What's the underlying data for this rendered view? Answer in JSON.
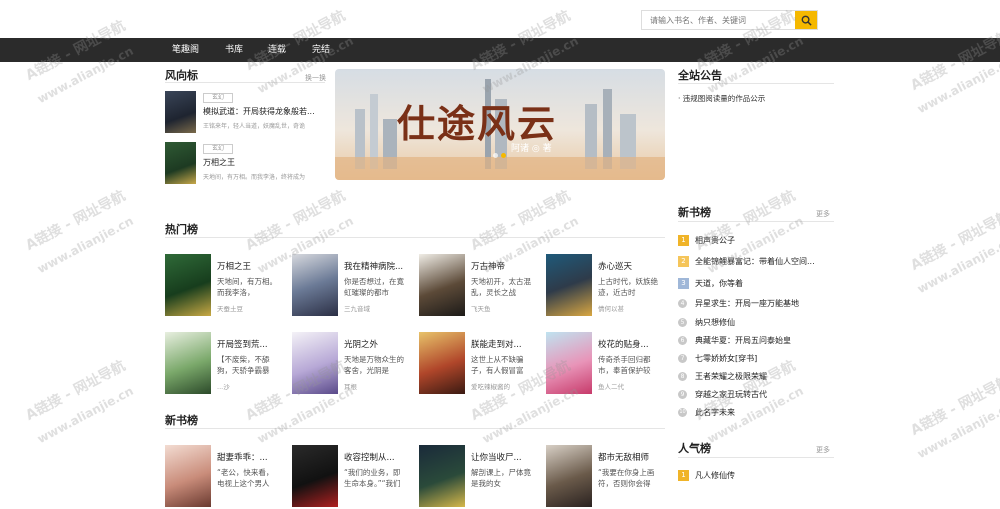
{
  "header": {
    "search_placeholder": "请输入书名、作者、关键词",
    "search_icon": "search-icon"
  },
  "nav": {
    "items": [
      "笔趣阁",
      "书库",
      "连载",
      "完结"
    ]
  },
  "fengxiang": {
    "title": "风向标",
    "more": "换一换",
    "items": [
      {
        "tag": "玄幻",
        "title": "模拟武道：开局获得龙象般若...",
        "desc": "王铭来年，轻人当道，妖魔乱世，奇诡"
      },
      {
        "tag": "玄幻",
        "title": "万相之王",
        "desc": "天地间，有万相。而我李洛，终将成为"
      }
    ]
  },
  "banner": {
    "title": "仕途风云",
    "author": "阿诸 ◎ 著",
    "active_dot": 1
  },
  "announcement": {
    "title": "全站公告",
    "items": [
      "· 违规图阅读量的作品公示"
    ]
  },
  "hot": {
    "title": "热门榜",
    "books": [
      {
        "title": "万相之王",
        "desc": "天地间，有万相。而我李洛，",
        "author": "天蚕土豆"
      },
      {
        "title": "我在精神病院...",
        "desc": "你是否想过，在寛虹璀璨的都市",
        "author": "三九音域"
      },
      {
        "title": "万古神帝",
        "desc": "天地初开，太古混乱，灵长之战",
        "author": "飞天鱼"
      },
      {
        "title": "赤心巡天",
        "desc": "上古时代，妖族绝迹，近古时",
        "author": "情何以甚"
      },
      {
        "title": "开局签到荒...",
        "desc": "【不废柴，不舔狗，天骄争霸暴",
        "author": "...沙"
      },
      {
        "title": "光阴之外",
        "desc": "天地是万物众生的客舍，光阴是",
        "author": "耳根"
      },
      {
        "title": "朕能走到对...",
        "desc": "这世上从不缺骗子，有人假冒富",
        "author": "爱吃辣椒酱的"
      },
      {
        "title": "校花的贴身...",
        "desc": "传奇杀手回归都市，奉首保护较",
        "author": "鱼人二代"
      }
    ]
  },
  "newbooks": {
    "title": "新书榜",
    "books": [
      {
        "title": "甜妻乖乖：...",
        "desc": "“老公，快来看，电视上这个男人"
      },
      {
        "title": "收容控制从...",
        "desc": "“我们的业务，即生命本身。”“我们"
      },
      {
        "title": "让你当收尸...",
        "desc": "解剖课上，尸体竟是我的女"
      },
      {
        "title": "都市无敌相师",
        "desc": "“我要在你身上画符，否则你会得"
      }
    ]
  },
  "newrank": {
    "title": "新书榜",
    "more": "更多",
    "items": [
      "相声贵公子",
      "全能锦鲤暴富记：带着仙人空间...",
      "天道，你等着",
      "异星求生：开局一座万能基地",
      "纳只想修仙",
      "典藏华夏：开局五问泰始皇",
      "七零娇娇女[穿书]",
      "王者荣耀之极限荣耀",
      "穿越之家丑玩转古代",
      "此名字未来"
    ]
  },
  "popular": {
    "title": "人气榜",
    "more": "更多",
    "items": [
      "凡人修仙传"
    ]
  },
  "watermark": {
    "line1": "A链接 - 网址导航",
    "line2": "www.alianjie.cn"
  },
  "colors": {
    "nav_bg": "#2b2b2b",
    "accent": "#f5b800",
    "rank1": "#f0b429",
    "rank2": "#f5c55a",
    "rank3": "#9fb7d8",
    "rank_other": "#c8c8c8"
  }
}
